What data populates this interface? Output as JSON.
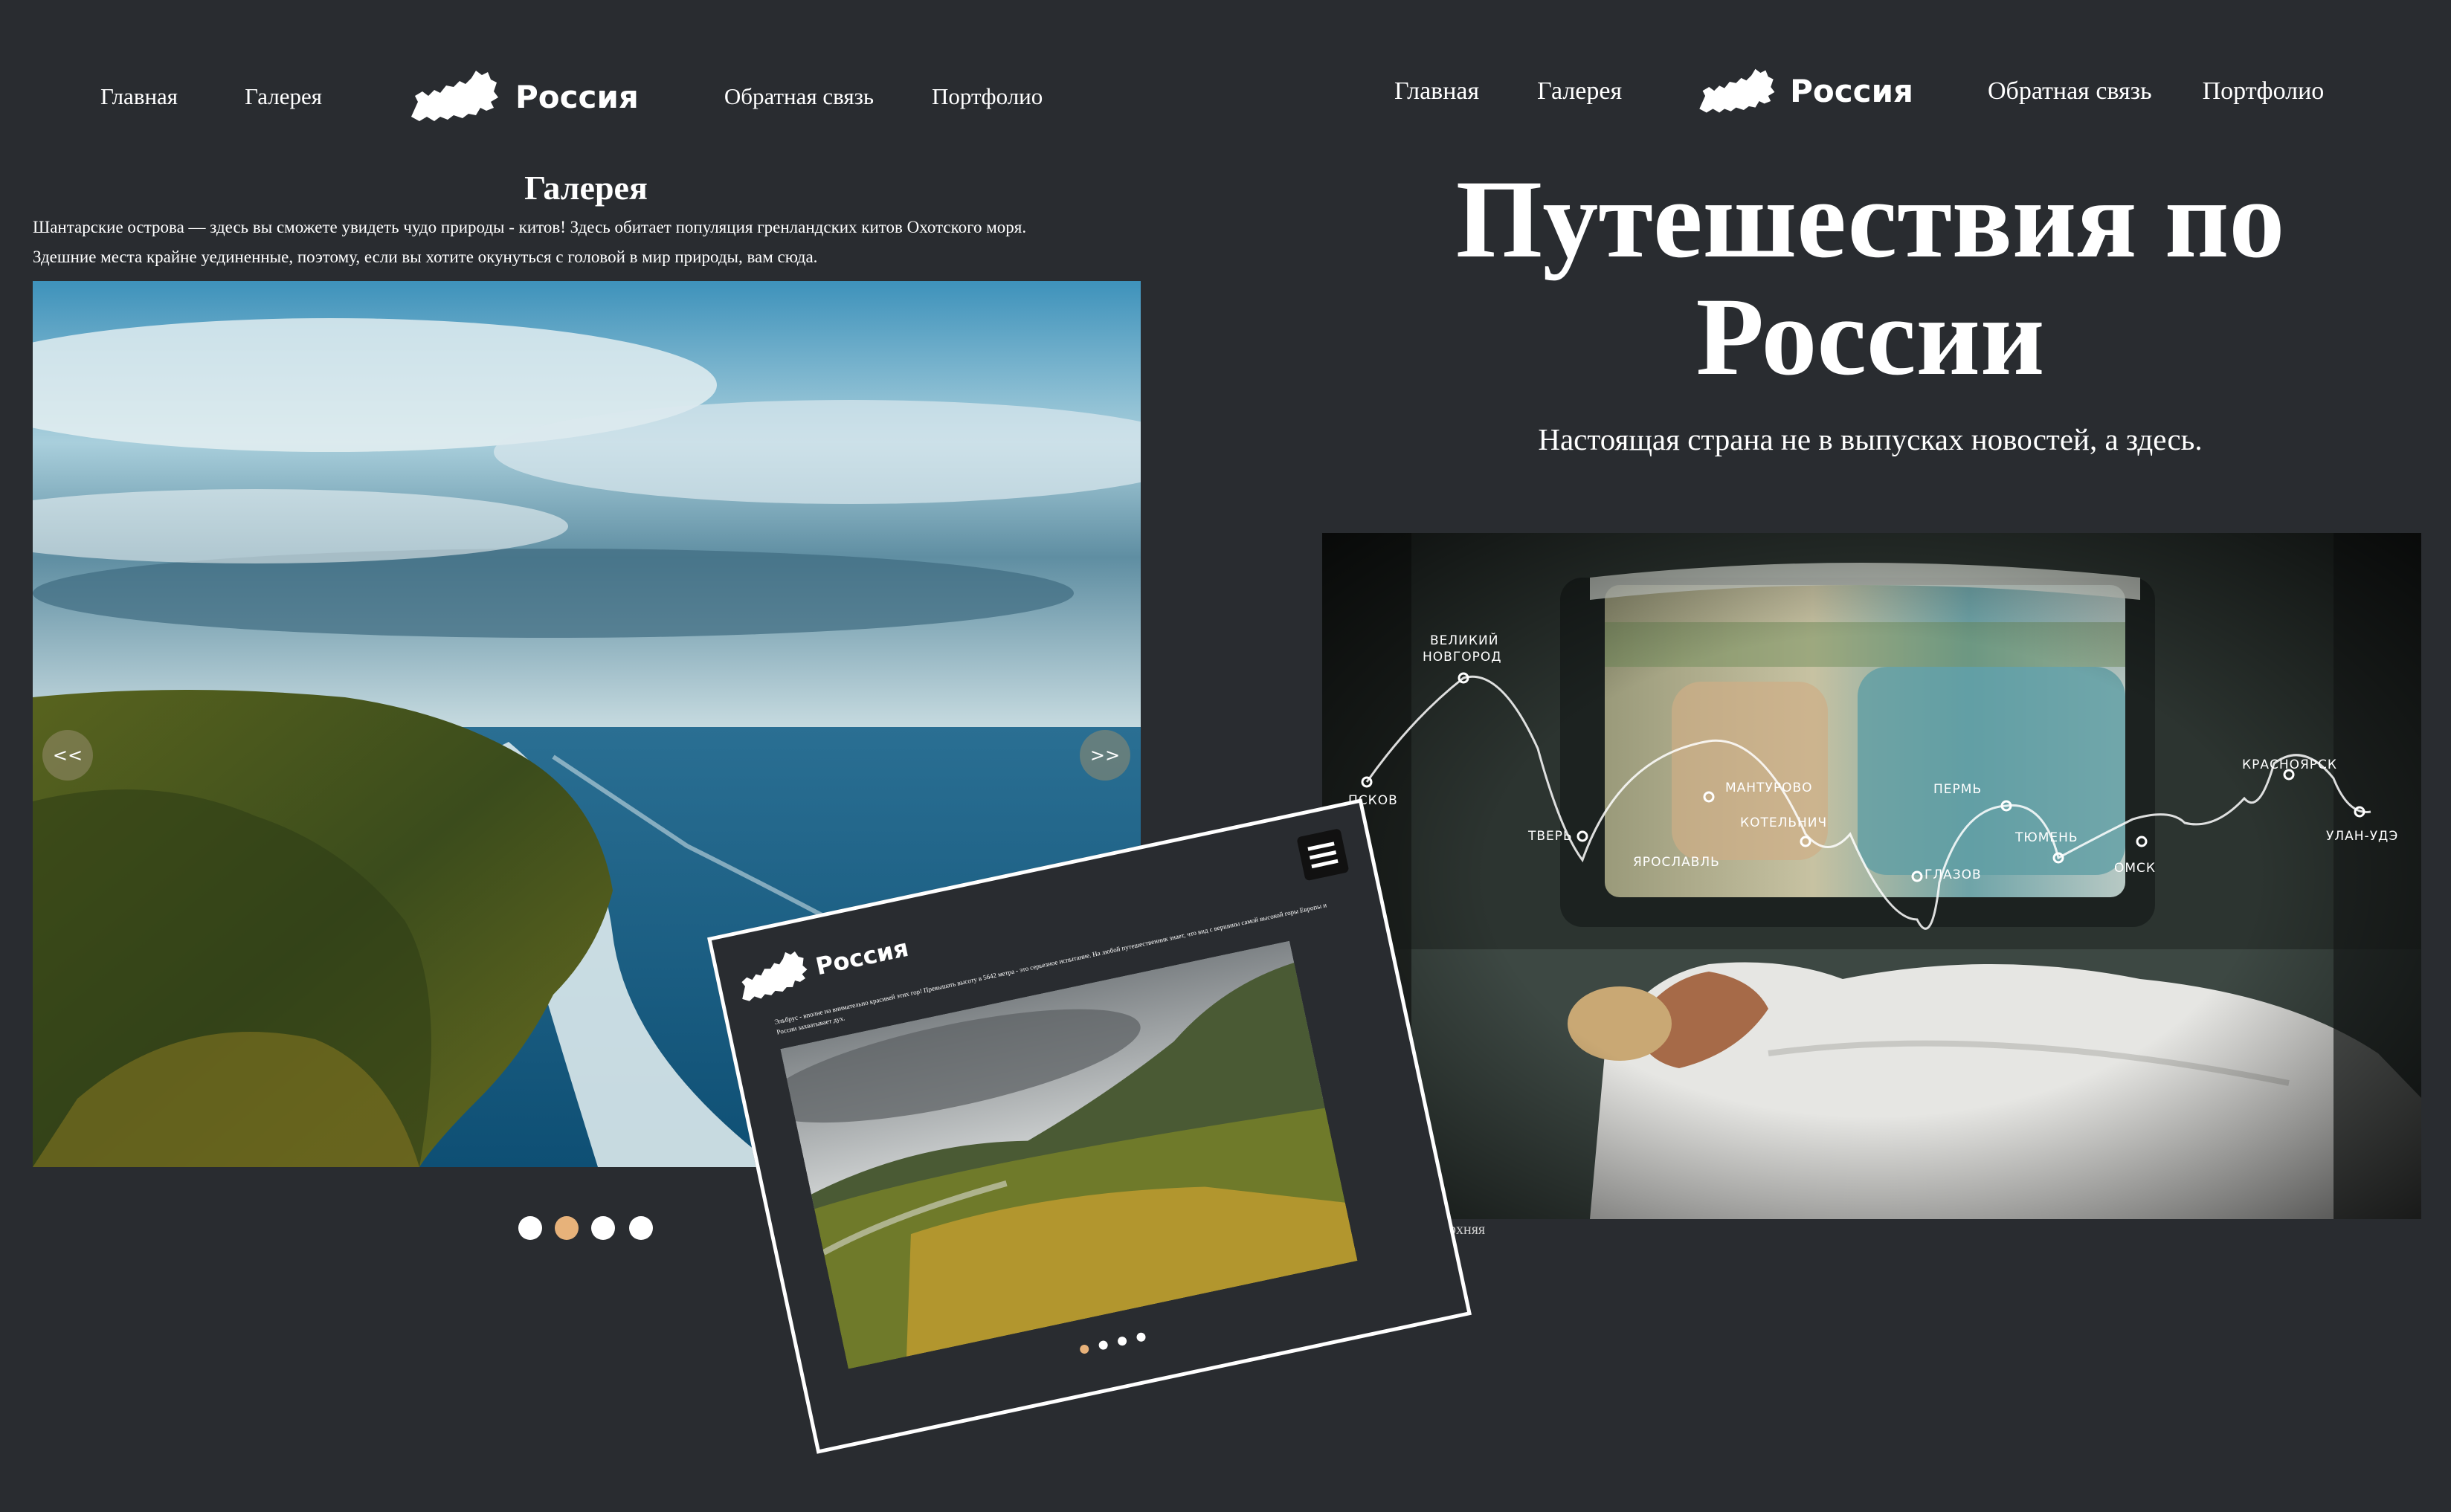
{
  "left_panel": {
    "nav": {
      "home": "Главная",
      "gallery": "Галерея",
      "brand": "Россия",
      "feedback": "Обратная связь",
      "portfolio": "Портфолио"
    },
    "title": "Галерея",
    "description_line1": "Шантарские острова — здесь вы сможете увидеть чудо природы - китов! Здесь обитает популяция гренландских китов Охотского моря.",
    "description_line2": "Здешние места крайне уединенные, поэтому, если вы хотите окунуться с головой в мир природы, вам сюда.",
    "prev_label": "<<",
    "next_label": ">>",
    "slider": {
      "total": 4,
      "active_index": 2
    }
  },
  "right_panel": {
    "nav": {
      "home": "Главная",
      "gallery": "Галерея",
      "brand": "Россия",
      "feedback": "Обратная связь",
      "portfolio": "Портфолио"
    },
    "hero_title_line1": "Путешествия по",
    "hero_title_line2": "России",
    "hero_subtitle": "Настоящая страна не в выпусках новостей, а здесь.",
    "caption_fragment": "рхняя",
    "route_cities": [
      "ПСКОВ",
      "ВЕЛИКИЙ",
      "НОВГОРОД",
      "ТВЕРЬ",
      "ЯРОСЛАВЛЬ",
      "МАНТУРОВО",
      "КОТЕЛЬНИЧ",
      "ГЛАЗОВ",
      "ПЕРМЬ",
      "ТЮМЕНЬ",
      "ОМСК",
      "КРАСНОЯРСК",
      "УЛАН-УДЭ"
    ]
  },
  "mobile_mockup": {
    "brand": "Россия",
    "text": "Эльбрус - вполне на внимательно красивей этих гор! Превышать высоту в 5642 метра - это серьезное испытание. На любой путешественник знает, что вид с вершины самой высокой горы Европы и России захватывает дух.",
    "slider": {
      "total": 4,
      "active_index": 0
    }
  },
  "colors": {
    "background": "#292c30",
    "accent_dot": "#e7b27a",
    "text": "#ffffff"
  }
}
